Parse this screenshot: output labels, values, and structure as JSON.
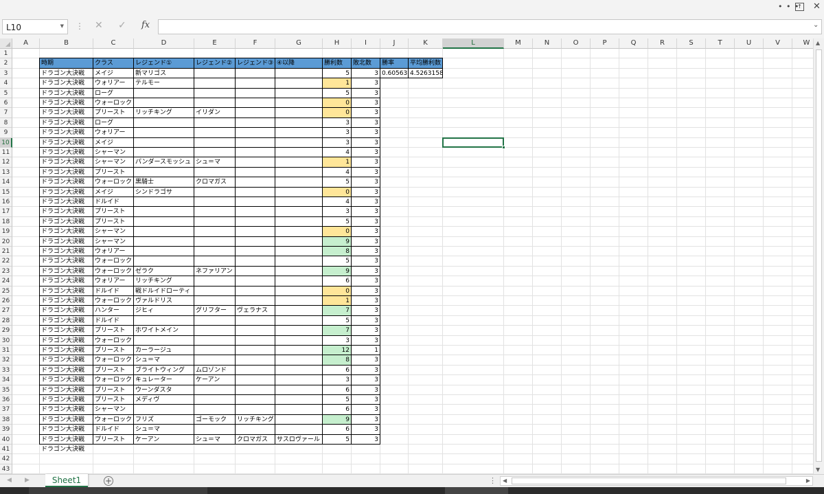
{
  "window": {
    "more_label": "• • •",
    "restore_label": "↑",
    "close_label": "✕"
  },
  "formula_bar": {
    "name_box": "L10",
    "cancel_icon": "✕",
    "enter_icon": "✓",
    "fx_label": "fx",
    "formula_value": ""
  },
  "columns": [
    "A",
    "B",
    "C",
    "D",
    "E",
    "F",
    "G",
    "H",
    "I",
    "J",
    "K",
    "L",
    "M",
    "N",
    "O",
    "P",
    "Q",
    "R",
    "S",
    "T",
    "U",
    "V",
    "W"
  ],
  "row_numbers": [
    "1",
    "2",
    "3",
    "4",
    "5",
    "6",
    "7",
    "8",
    "9",
    "10",
    "11",
    "12",
    "13",
    "14",
    "15",
    "16",
    "17",
    "18",
    "19",
    "20",
    "21",
    "22",
    "23",
    "24",
    "25",
    "26",
    "27",
    "28",
    "29",
    "30",
    "31",
    "32",
    "33",
    "34",
    "35",
    "36",
    "37",
    "38",
    "39",
    "40",
    "41",
    "42",
    "43"
  ],
  "selected_cell": {
    "col": "L",
    "row": "10"
  },
  "colors": {
    "header_fill": "#5b9bd5",
    "highlight_yellow": "#ffe699",
    "highlight_green": "#c6efce",
    "accent": "#217346"
  },
  "table": {
    "headers": [
      "時期",
      "クラス",
      "レジェンド①",
      "レジェンド②",
      "レジェンド③",
      "④以降",
      "勝利数",
      "敗北数"
    ],
    "rows": [
      {
        "period": "ドラゴン大決戦",
        "cls": "メイジ",
        "l1": "新マリゴス",
        "l2": "",
        "l3": "",
        "l4": "",
        "wins": 5,
        "losses": 3,
        "hl": ""
      },
      {
        "period": "ドラゴン大決戦",
        "cls": "ウォリアー",
        "l1": "テルモー",
        "l2": "",
        "l3": "",
        "l4": "",
        "wins": 1,
        "losses": 3,
        "hl": "y"
      },
      {
        "period": "ドラゴン大決戦",
        "cls": "ローグ",
        "l1": "",
        "l2": "",
        "l3": "",
        "l4": "",
        "wins": 5,
        "losses": 3,
        "hl": ""
      },
      {
        "period": "ドラゴン大決戦",
        "cls": "ウォーロック",
        "l1": "",
        "l2": "",
        "l3": "",
        "l4": "",
        "wins": 0,
        "losses": 3,
        "hl": "y"
      },
      {
        "period": "ドラゴン大決戦",
        "cls": "プリースト",
        "l1": "リッチキング",
        "l2": "イリダン",
        "l3": "",
        "l4": "",
        "wins": 0,
        "losses": 3,
        "hl": "y"
      },
      {
        "period": "ドラゴン大決戦",
        "cls": "ローグ",
        "l1": "",
        "l2": "",
        "l3": "",
        "l4": "",
        "wins": 3,
        "losses": 3,
        "hl": ""
      },
      {
        "period": "ドラゴン大決戦",
        "cls": "ウォリアー",
        "l1": "",
        "l2": "",
        "l3": "",
        "l4": "",
        "wins": 3,
        "losses": 3,
        "hl": ""
      },
      {
        "period": "ドラゴン大決戦",
        "cls": "メイジ",
        "l1": "",
        "l2": "",
        "l3": "",
        "l4": "",
        "wins": 3,
        "losses": 3,
        "hl": ""
      },
      {
        "period": "ドラゴン大決戦",
        "cls": "シャーマン",
        "l1": "",
        "l2": "",
        "l3": "",
        "l4": "",
        "wins": 4,
        "losses": 3,
        "hl": ""
      },
      {
        "period": "ドラゴン大決戦",
        "cls": "シャーマン",
        "l1": "パンダースモッシュ",
        "l2": "シュ＝マ",
        "l3": "",
        "l4": "",
        "wins": 1,
        "losses": 3,
        "hl": "y"
      },
      {
        "period": "ドラゴン大決戦",
        "cls": "プリースト",
        "l1": "",
        "l2": "",
        "l3": "",
        "l4": "",
        "wins": 4,
        "losses": 3,
        "hl": ""
      },
      {
        "period": "ドラゴン大決戦",
        "cls": "ウォーロック",
        "l1": "黒騎士",
        "l2": "クロマガス",
        "l3": "",
        "l4": "",
        "wins": 5,
        "losses": 3,
        "hl": ""
      },
      {
        "period": "ドラゴン大決戦",
        "cls": "メイジ",
        "l1": "シンドラゴサ",
        "l2": "",
        "l3": "",
        "l4": "",
        "wins": 0,
        "losses": 3,
        "hl": "y"
      },
      {
        "period": "ドラゴン大決戦",
        "cls": "ドルイド",
        "l1": "",
        "l2": "",
        "l3": "",
        "l4": "",
        "wins": 4,
        "losses": 3,
        "hl": ""
      },
      {
        "period": "ドラゴン大決戦",
        "cls": "プリースト",
        "l1": "",
        "l2": "",
        "l3": "",
        "l4": "",
        "wins": 3,
        "losses": 3,
        "hl": ""
      },
      {
        "period": "ドラゴン大決戦",
        "cls": "プリースト",
        "l1": "",
        "l2": "",
        "l3": "",
        "l4": "",
        "wins": 5,
        "losses": 3,
        "hl": ""
      },
      {
        "period": "ドラゴン大決戦",
        "cls": "シャーマン",
        "l1": "",
        "l2": "",
        "l3": "",
        "l4": "",
        "wins": 0,
        "losses": 3,
        "hl": "y"
      },
      {
        "period": "ドラゴン大決戦",
        "cls": "シャーマン",
        "l1": "",
        "l2": "",
        "l3": "",
        "l4": "",
        "wins": 9,
        "losses": 3,
        "hl": "g"
      },
      {
        "period": "ドラゴン大決戦",
        "cls": "ウォリアー",
        "l1": "",
        "l2": "",
        "l3": "",
        "l4": "",
        "wins": 8,
        "losses": 3,
        "hl": "g"
      },
      {
        "period": "ドラゴン大決戦",
        "cls": "ウォーロック",
        "l1": "",
        "l2": "",
        "l3": "",
        "l4": "",
        "wins": 5,
        "losses": 3,
        "hl": ""
      },
      {
        "period": "ドラゴン大決戦",
        "cls": "ウォーロック",
        "l1": "ゼラク",
        "l2": "ネファリアン",
        "l3": "",
        "l4": "",
        "wins": 9,
        "losses": 3,
        "hl": "g"
      },
      {
        "period": "ドラゴン大決戦",
        "cls": "ウォリアー",
        "l1": "リッチキング",
        "l2": "",
        "l3": "",
        "l4": "",
        "wins": 6,
        "losses": 3,
        "hl": ""
      },
      {
        "period": "ドラゴン大決戦",
        "cls": "ドルイド",
        "l1": "戦ドルイドローティ",
        "l2": "",
        "l3": "",
        "l4": "",
        "wins": 0,
        "losses": 3,
        "hl": "y"
      },
      {
        "period": "ドラゴン大決戦",
        "cls": "ウォーロック",
        "l1": "ヴァルドリス",
        "l2": "",
        "l3": "",
        "l4": "",
        "wins": 1,
        "losses": 3,
        "hl": "y"
      },
      {
        "period": "ドラゴン大決戦",
        "cls": "ハンター",
        "l1": "ジヒィ",
        "l2": "グリフター",
        "l3": "ヴェラナス",
        "l4": "",
        "wins": 7,
        "losses": 3,
        "hl": "g"
      },
      {
        "period": "ドラゴン大決戦",
        "cls": "ドルイド",
        "l1": "",
        "l2": "",
        "l3": "",
        "l4": "",
        "wins": 5,
        "losses": 3,
        "hl": ""
      },
      {
        "period": "ドラゴン大決戦",
        "cls": "プリースト",
        "l1": "ホワイトメイン",
        "l2": "",
        "l3": "",
        "l4": "",
        "wins": 7,
        "losses": 3,
        "hl": "g"
      },
      {
        "period": "ドラゴン大決戦",
        "cls": "ウォーロック",
        "l1": "",
        "l2": "",
        "l3": "",
        "l4": "",
        "wins": 3,
        "losses": 3,
        "hl": ""
      },
      {
        "period": "ドラゴン大決戦",
        "cls": "プリースト",
        "l1": "カーラージュ",
        "l2": "",
        "l3": "",
        "l4": "",
        "wins": 12,
        "losses": 1,
        "hl": "g"
      },
      {
        "period": "ドラゴン大決戦",
        "cls": "ウォーロック",
        "l1": "シュ＝マ",
        "l2": "",
        "l3": "",
        "l4": "",
        "wins": 8,
        "losses": 3,
        "hl": "g"
      },
      {
        "period": "ドラゴン大決戦",
        "cls": "プリースト",
        "l1": "ブライトウィング",
        "l2": "ムロゾンド",
        "l3": "",
        "l4": "",
        "wins": 6,
        "losses": 3,
        "hl": ""
      },
      {
        "period": "ドラゴン大決戦",
        "cls": "ウォーロック",
        "l1": "キュレーター",
        "l2": "ケーアン",
        "l3": "",
        "l4": "",
        "wins": 3,
        "losses": 3,
        "hl": ""
      },
      {
        "period": "ドラゴン大決戦",
        "cls": "プリースト",
        "l1": "ウーンダスタ",
        "l2": "",
        "l3": "",
        "l4": "",
        "wins": 6,
        "losses": 3,
        "hl": ""
      },
      {
        "period": "ドラゴン大決戦",
        "cls": "プリースト",
        "l1": "メディヴ",
        "l2": "",
        "l3": "",
        "l4": "",
        "wins": 5,
        "losses": 3,
        "hl": ""
      },
      {
        "period": "ドラゴン大決戦",
        "cls": "シャーマン",
        "l1": "",
        "l2": "",
        "l3": "",
        "l4": "",
        "wins": 6,
        "losses": 3,
        "hl": ""
      },
      {
        "period": "ドラゴン大決戦",
        "cls": "ウォーロック",
        "l1": "フリズ",
        "l2": "ゴーモック",
        "l3": "リッチキング",
        "l4": "",
        "wins": 9,
        "losses": 3,
        "hl": "g"
      },
      {
        "period": "ドラゴン大決戦",
        "cls": "ドルイド",
        "l1": "シュ＝マ",
        "l2": "",
        "l3": "",
        "l4": "",
        "wins": 6,
        "losses": 3,
        "hl": ""
      },
      {
        "period": "ドラゴン大決戦",
        "cls": "プリースト",
        "l1": "ケーアン",
        "l2": "シュ＝マ",
        "l3": "クロマガス",
        "l4": "サスロヴァール",
        "wins": 5,
        "losses": 3,
        "hl": ""
      }
    ],
    "extra_row": "ドラゴン大決戦"
  },
  "stats": {
    "win_rate_label": "勝率",
    "avg_wins_label": "平均勝利数",
    "win_rate_value": "0.60563",
    "avg_wins_value": "4.5263158"
  },
  "tabs": {
    "sheet_name": "Sheet1",
    "add_label": "+",
    "prev_label": "◀",
    "next_label": "▶"
  }
}
